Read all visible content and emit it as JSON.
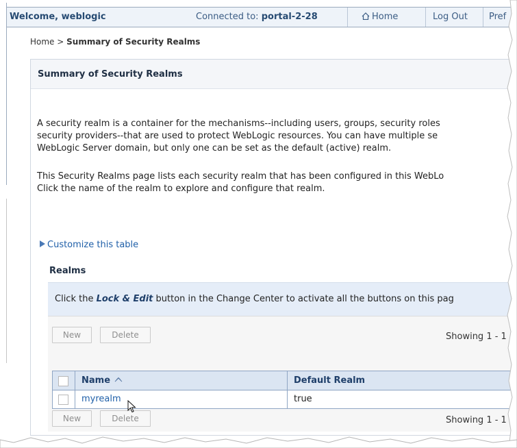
{
  "header": {
    "welcome": "Welcome, weblogic",
    "connected_label": "Connected to:",
    "connected_server": "portal-2-28",
    "home": "Home",
    "logout": "Log Out",
    "preferences_partial": "Pref"
  },
  "breadcrumb": {
    "home": "Home",
    "separator": ">",
    "current": "Summary of Security Realms"
  },
  "panel": {
    "title": "Summary of Security Realms",
    "paragraph1": [
      "A security realm is a container for the mechanisms--including users, groups, security roles",
      "security providers--that are used to protect WebLogic resources. You can have multiple se",
      "WebLogic Server domain, but only one can be set as the default (active) realm."
    ],
    "paragraph2": [
      "This Security Realms page lists each security realm that has been configured in this WebLo",
      "Click the name of the realm to explore and configure that realm."
    ]
  },
  "customize_link": "Customize this table",
  "realms": {
    "title": "Realms",
    "info_prefix": "Click the ",
    "info_emphasis": "Lock & Edit",
    "info_suffix": " button in the Change Center to activate all the buttons on this pag",
    "buttons": {
      "new": "New",
      "delete": "Delete"
    },
    "showing": "Showing 1 - 1",
    "columns": {
      "name": "Name",
      "default_realm": "Default Realm"
    },
    "rows": [
      {
        "name": "myrealm",
        "default_realm": "true"
      }
    ]
  },
  "icons": {
    "home": "house-icon",
    "expand": "triangle-right-icon",
    "sort": "sort-ascending-icon",
    "cursor": "mouse-pointer-icon"
  },
  "colors": {
    "link": "#1f5fa8",
    "header_bg": "#eef3f9",
    "table_header_bg": "#dbe5f2",
    "info_bg": "#e5edf8"
  }
}
